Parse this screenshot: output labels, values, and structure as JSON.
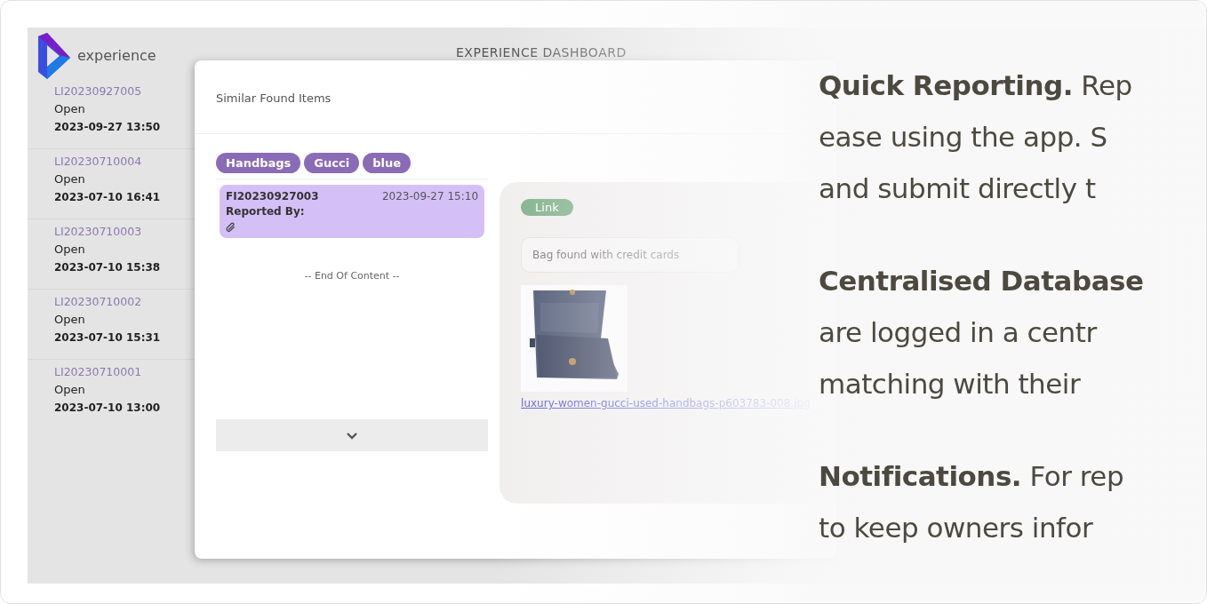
{
  "app": {
    "logo_text": "experience",
    "title": "EXPERIENCE DASHBOARD"
  },
  "sidebar": {
    "items": [
      {
        "id": "LI20230927005",
        "status": "Open",
        "time": "2023-09-27 13:50"
      },
      {
        "id": "LI20230710004",
        "status": "Open",
        "time": "2023-07-10 16:41"
      },
      {
        "id": "LI20230710003",
        "status": "Open",
        "time": "2023-07-10 15:38"
      },
      {
        "id": "LI20230710002",
        "status": "Open",
        "time": "2023-07-10 15:31"
      },
      {
        "id": "LI20230710001",
        "status": "Open",
        "time": "2023-07-10 13:00"
      }
    ]
  },
  "modal": {
    "title": "Similar Found Items",
    "tags": [
      "Handbags",
      "Gucci",
      "blue"
    ],
    "items": [
      {
        "id": "FI20230927003",
        "time": "2023-09-27 15:10",
        "reported_by": "Reported By:",
        "selected": true,
        "attachment": true
      }
    ],
    "end_text": "-- End Of Content --",
    "detail": {
      "badge": "Link",
      "description": "Bag found with credit cards",
      "file_link": "luxury-women-gucci-used-handbags-p603783-008.jpg"
    }
  },
  "features": [
    {
      "lines": [
        "**Quick Reporting.** Rep",
        "ease using the app. S",
        "and submit directly t"
      ]
    },
    {
      "lines": [
        "**Centralised Database**",
        "are logged in a centr",
        "matching with their"
      ]
    },
    {
      "lines": [
        "**Notifications.** For rep",
        "to keep owners infor"
      ]
    }
  ]
}
